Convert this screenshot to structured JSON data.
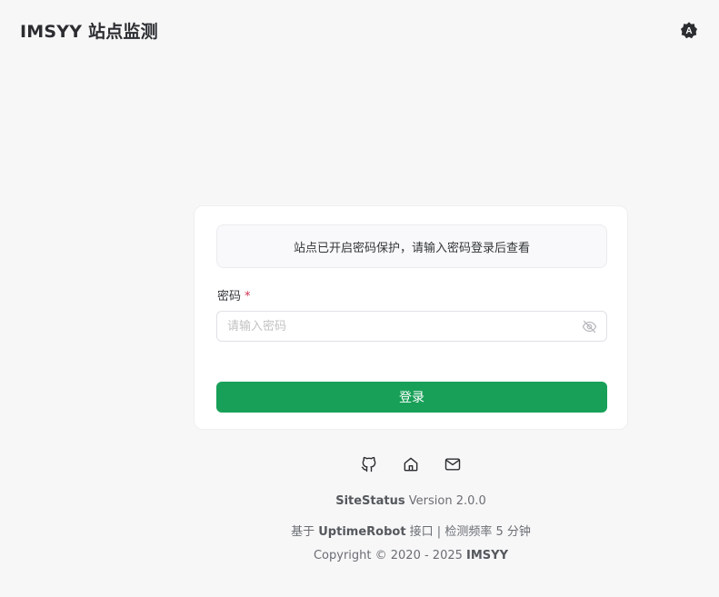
{
  "header": {
    "title": "IMSYY 站点监测",
    "theme_icon": "auto-theme-icon"
  },
  "login": {
    "notice": "站点已开启密码保护，请输入密码登录后查看",
    "password_label": "密码",
    "required_mark": "*",
    "password_value": "",
    "password_placeholder": "请输入密码",
    "toggle_icon": "eye-icon",
    "submit_label": "登录"
  },
  "footer": {
    "links": [
      {
        "icon": "github-icon"
      },
      {
        "icon": "home-icon"
      },
      {
        "icon": "mail-icon"
      }
    ],
    "app_name": "SiteStatus",
    "version_text": " Version 2.0.0",
    "based_prefix": "基于 ",
    "api_name": "UptimeRobot",
    "based_suffix": " 接口 | 检测频率 5 分钟",
    "copyright_prefix": "Copyright © 2020 - 2025 ",
    "copyright_owner": "IMSYY"
  },
  "colors": {
    "primary": "#18a058",
    "required": "#d03050",
    "background": "#f7f7f8"
  }
}
